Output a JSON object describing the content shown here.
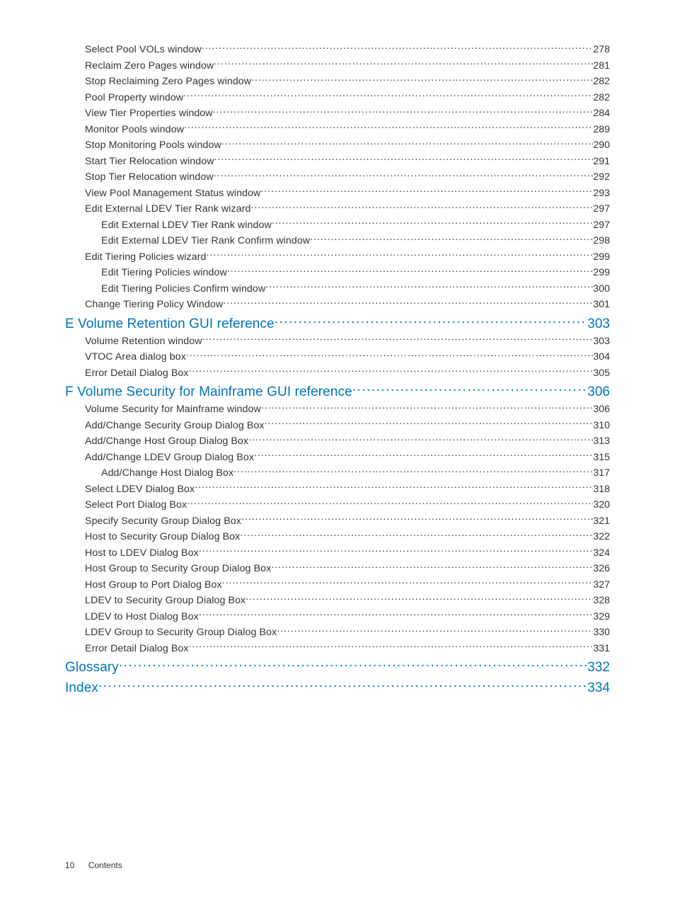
{
  "entries": [
    {
      "level": 2,
      "label": "Select Pool VOLs window",
      "page": "278"
    },
    {
      "level": 2,
      "label": "Reclaim Zero Pages window",
      "page": "281"
    },
    {
      "level": 2,
      "label": "Stop Reclaiming Zero Pages window",
      "page": "282"
    },
    {
      "level": 2,
      "label": "Pool Property window",
      "page": "282"
    },
    {
      "level": 2,
      "label": "View Tier Properties window",
      "page": "284"
    },
    {
      "level": 2,
      "label": "Monitor Pools window",
      "page": "289"
    },
    {
      "level": 2,
      "label": "Stop Monitoring Pools window",
      "page": "290"
    },
    {
      "level": 2,
      "label": "Start Tier Relocation window",
      "page": "291"
    },
    {
      "level": 2,
      "label": "Stop Tier Relocation window",
      "page": "292"
    },
    {
      "level": 2,
      "label": "View Pool Management Status window",
      "page": "293"
    },
    {
      "level": 2,
      "label": "Edit External LDEV Tier Rank wizard",
      "page": "297"
    },
    {
      "level": 3,
      "label": "Edit External LDEV Tier Rank window",
      "page": "297"
    },
    {
      "level": 3,
      "label": "Edit External LDEV Tier Rank Confirm window",
      "page": "298"
    },
    {
      "level": 2,
      "label": "Edit Tiering Policies wizard",
      "page": "299"
    },
    {
      "level": 3,
      "label": "Edit Tiering Policies window",
      "page": "299"
    },
    {
      "level": 3,
      "label": "Edit Tiering Policies Confirm window",
      "page": "300"
    },
    {
      "level": 2,
      "label": "Change Tiering Policy Window",
      "page": "301"
    },
    {
      "level": 1,
      "label": "E Volume Retention GUI reference",
      "page": "303"
    },
    {
      "level": 2,
      "label": "Volume Retention window",
      "page": "303"
    },
    {
      "level": 2,
      "label": "VTOC Area dialog box",
      "page": "304"
    },
    {
      "level": 2,
      "label": "Error Detail Dialog Box",
      "page": "305"
    },
    {
      "level": 1,
      "label": "F Volume Security for Mainframe GUI reference",
      "page": "306"
    },
    {
      "level": 2,
      "label": "Volume Security for Mainframe window",
      "page": "306"
    },
    {
      "level": 2,
      "label": "Add/Change Security Group Dialog Box",
      "page": "310"
    },
    {
      "level": 2,
      "label": "Add/Change Host Group Dialog Box",
      "page": "313"
    },
    {
      "level": 2,
      "label": "Add/Change LDEV Group Dialog Box",
      "page": "315"
    },
    {
      "level": 3,
      "label": "Add/Change Host Dialog Box",
      "page": "317"
    },
    {
      "level": 2,
      "label": "Select LDEV Dialog Box",
      "page": "318"
    },
    {
      "level": 2,
      "label": "Select Port Dialog Box",
      "page": "320"
    },
    {
      "level": 2,
      "label": "Specify Security Group Dialog Box",
      "page": "321"
    },
    {
      "level": 2,
      "label": "Host to Security Group Dialog Box",
      "page": "322"
    },
    {
      "level": 2,
      "label": "Host to LDEV Dialog Box",
      "page": "324"
    },
    {
      "level": 2,
      "label": "Host Group to Security Group Dialog Box",
      "page": "326"
    },
    {
      "level": 2,
      "label": "Host Group to Port Dialog Box",
      "page": "327"
    },
    {
      "level": 2,
      "label": "LDEV to Security Group Dialog Box",
      "page": "328"
    },
    {
      "level": 2,
      "label": "LDEV to Host Dialog Box",
      "page": "329"
    },
    {
      "level": 2,
      "label": "LDEV Group to Security Group Dialog Box",
      "page": "330"
    },
    {
      "level": 2,
      "label": "Error Detail Dialog Box",
      "page": "331"
    },
    {
      "level": 1,
      "label": "Glossary",
      "page": "332"
    },
    {
      "level": 1,
      "label": "Index",
      "page": "334"
    }
  ],
  "footer": {
    "page_number": "10",
    "section": "Contents"
  }
}
